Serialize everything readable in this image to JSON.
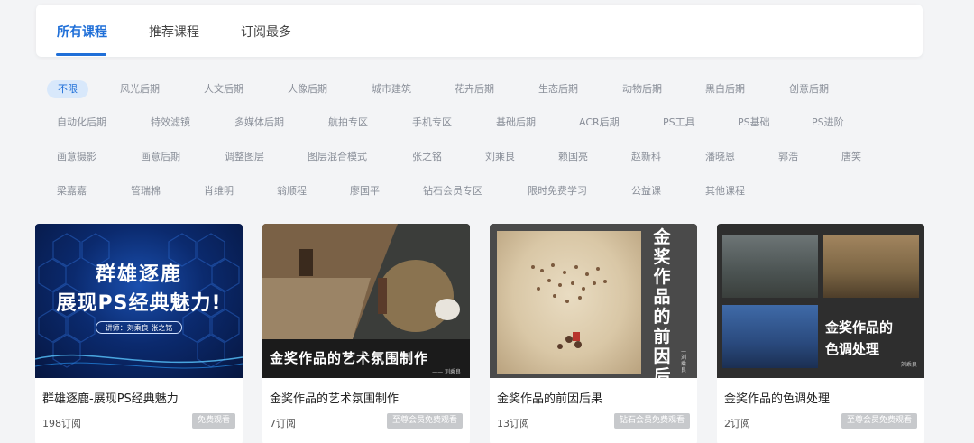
{
  "tabs": [
    "所有课程",
    "推荐课程",
    "订阅最多"
  ],
  "filters": {
    "row1": [
      "不限",
      "风光后期",
      "人文后期",
      "人像后期",
      "城市建筑",
      "花卉后期",
      "生态后期",
      "动物后期",
      "黑白后期",
      "创意后期"
    ],
    "row2": [
      "自动化后期",
      "特效滤镜",
      "多媒体后期",
      "航拍专区",
      "手机专区",
      "基础后期",
      "ACR后期",
      "PS工具",
      "PS基础",
      "PS进阶"
    ],
    "row3": [
      "画意摄影",
      "画意后期",
      "调整图层",
      "图层混合模式",
      "张之铭",
      "刘乘良",
      "赖国亮",
      "赵新科",
      "潘晓恩",
      "郭浩",
      "唐笑"
    ],
    "row4": [
      "梁嘉嘉",
      "管瑞棉",
      "肖维明",
      "翁顺程",
      "廖国平",
      "钻石会员专区",
      "限时免费学习",
      "公益课",
      "其他课程"
    ]
  },
  "courses": [
    {
      "title": "群雄逐鹿-展现PS经典魅力",
      "subs": "198订阅",
      "badge": "免费观看",
      "thumb_line1": "群雄逐鹿",
      "thumb_line2": "展现PS经典魅力!",
      "thumb_pill": "讲师：刘乘良  张之铭"
    },
    {
      "title": "金奖作品的艺术氛围制作",
      "subs": "7订阅",
      "badge": "至尊会员免费观看",
      "thumb_title": "金奖作品的艺术氛围制作",
      "thumb_credit": "—— 刘乘良"
    },
    {
      "title": "金奖作品的前因后果",
      "subs": "13订阅",
      "badge": "钻石会员免费观看",
      "thumb_title": "金奖作品的前因后果",
      "thumb_credit": "—刘乘良"
    },
    {
      "title": "金奖作品的色调处理",
      "subs": "2订阅",
      "badge": "至尊会员免费观看",
      "thumb_title1": "金奖作品的",
      "thumb_title2": "色调处理",
      "thumb_credit": "—— 刘乘良"
    }
  ],
  "colors": {
    "accent": "#1f6fd8",
    "tag_active_bg": "#d8e8fb",
    "badge_bg": "#c7c9cc",
    "page_bg": "#f3f4f6"
  }
}
